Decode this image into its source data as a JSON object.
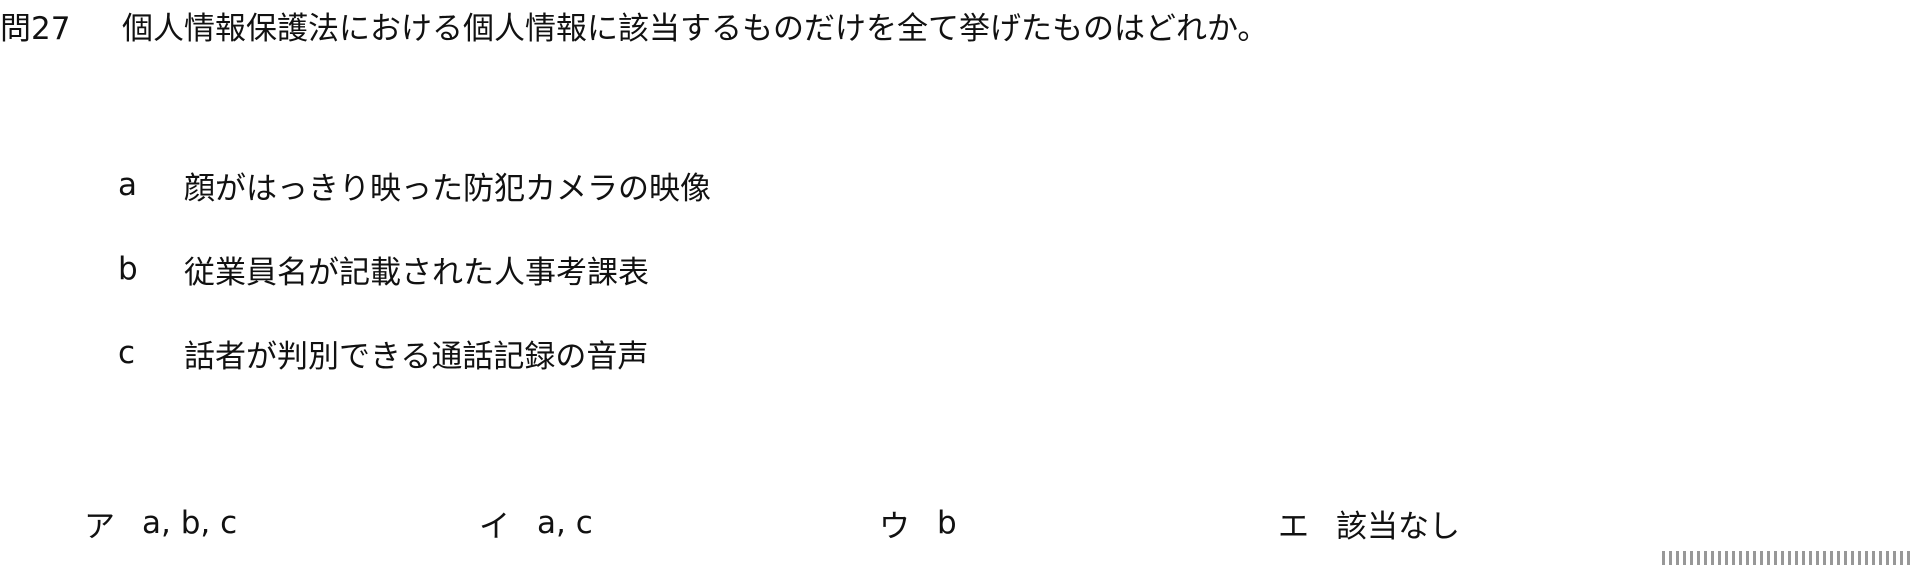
{
  "question": {
    "number": "問27",
    "text": "個人情報保護法における個人情報に該当するものだけを全て挙げたものはどれか。"
  },
  "items": [
    {
      "letter": "a",
      "text": "顔がはっきり映った防犯カメラの映像"
    },
    {
      "letter": "b",
      "text": "従業員名が記載された人事考課表"
    },
    {
      "letter": "c",
      "text": "話者が判別できる通話記録の音声"
    }
  ],
  "choices": [
    {
      "letter": "ア",
      "text": "a, b, c"
    },
    {
      "letter": "イ",
      "text": "a, c"
    },
    {
      "letter": "ウ",
      "text": "b"
    },
    {
      "letter": "エ",
      "text": "該当なし"
    }
  ]
}
